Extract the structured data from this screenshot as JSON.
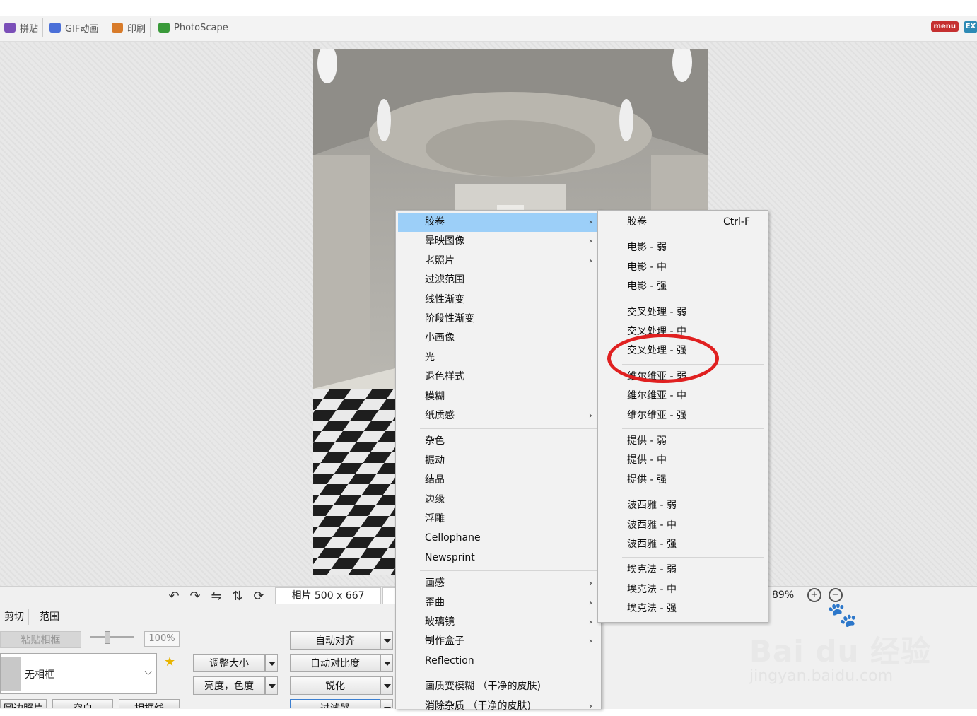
{
  "tabs": [
    {
      "label": "拼贴",
      "color": "#7b4fb8"
    },
    {
      "label": "GIF动画",
      "color": "#4a6fd8"
    },
    {
      "label": "印刷",
      "color": "#d87b2a"
    },
    {
      "label": "PhotoScape",
      "color": "#3a9a3a"
    }
  ],
  "top_right": {
    "menu_label": "menu",
    "ex_label": "EX"
  },
  "status": {
    "photo_info": "相片 500 x 667",
    "zoom": "89%"
  },
  "panel": {
    "subtabs": [
      "剪切",
      "范围"
    ],
    "paste_frame": "粘贴相框",
    "percent": "100%",
    "frame_value": "无相框",
    "resize": "调整大小",
    "brightness": "亮度，色度",
    "auto_align": "自动对齐",
    "auto_contrast": "自动对比度",
    "sharpen": "锐化",
    "filter": "过滤器",
    "bottom_buttons": [
      "圆边照片",
      "空白",
      "相框线"
    ]
  },
  "menu1": [
    {
      "label": "胶卷",
      "arrow": "›",
      "hl": true
    },
    {
      "label": "晕映图像",
      "arrow": "›"
    },
    {
      "label": "老照片",
      "arrow": "›"
    },
    {
      "label": "过滤范围"
    },
    {
      "label": "线性渐变"
    },
    {
      "label": "阶段性渐变"
    },
    {
      "label": "小画像"
    },
    {
      "label": "光"
    },
    {
      "label": "退色样式"
    },
    {
      "label": "模糊"
    },
    {
      "label": "纸质感",
      "arrow": "›"
    },
    {
      "sep": true
    },
    {
      "label": "杂色"
    },
    {
      "label": "振动"
    },
    {
      "label": "结晶"
    },
    {
      "label": "边缘"
    },
    {
      "label": "浮雕"
    },
    {
      "label": "Cellophane"
    },
    {
      "label": "Newsprint"
    },
    {
      "sep": true
    },
    {
      "label": "画感",
      "arrow": "›"
    },
    {
      "label": "歪曲",
      "arrow": "›"
    },
    {
      "label": "玻璃镜",
      "arrow": "›"
    },
    {
      "label": "制作盒子",
      "arrow": "›"
    },
    {
      "label": "Reflection"
    },
    {
      "sep": true
    },
    {
      "label": "画质变模糊 （干净的皮肤)"
    },
    {
      "label": "消除杂质 （干净的皮肤)",
      "arrow": "›"
    }
  ],
  "menu2": [
    {
      "label": "胶卷",
      "shortcut": "Ctrl-F"
    },
    {
      "sep": true
    },
    {
      "label": "电影 - 弱"
    },
    {
      "label": "电影 - 中"
    },
    {
      "label": "电影 - 强"
    },
    {
      "sep": true
    },
    {
      "label": "交叉处理 - 弱"
    },
    {
      "label": "交叉处理 - 中"
    },
    {
      "label": "交叉处理 - 强"
    },
    {
      "sep": true
    },
    {
      "label": "维尔维亚 - 弱"
    },
    {
      "label": "维尔维亚 - 中"
    },
    {
      "label": "维尔维亚 - 强"
    },
    {
      "sep": true
    },
    {
      "label": "提供 - 弱"
    },
    {
      "label": "提供 - 中"
    },
    {
      "label": "提供 - 强"
    },
    {
      "sep": true
    },
    {
      "label": "波西雅 - 弱"
    },
    {
      "label": "波西雅 - 中"
    },
    {
      "label": "波西雅 - 强"
    },
    {
      "sep": true
    },
    {
      "label": "埃克法 - 弱"
    },
    {
      "label": "埃克法 - 中"
    },
    {
      "label": "埃克法 - 强"
    }
  ],
  "watermark": {
    "brand": "Bai du 经验",
    "url": "jingyan.baidu.com"
  },
  "colors": {
    "highlight": "#9ccff8",
    "annotation": "#e02020"
  }
}
